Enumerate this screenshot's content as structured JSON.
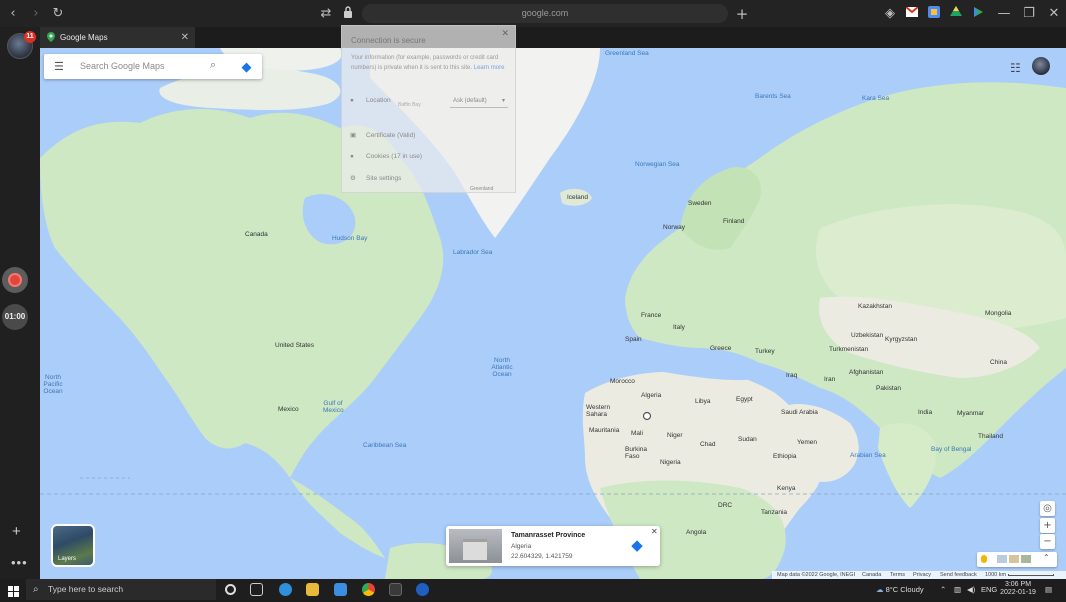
{
  "browser": {
    "url": "google.com",
    "tab_title": "Google Maps",
    "profile_badge": "11",
    "timer": "01:00"
  },
  "maps": {
    "search_placeholder": "Search Google Maps",
    "layers_label": "Layers"
  },
  "security_popup": {
    "title": "Connection is secure",
    "description": "Your information (for example, passwords or credit card numbers) is private when it is sent to this site.",
    "learn_more": "Learn more",
    "location_label": "Location",
    "location_sub": "Baffin Bay",
    "location_value": "Ask (default)",
    "certificate": "Certificate (Valid)",
    "cookies": "Cookies (17 in use)",
    "site_settings": "Site settings",
    "bottom_label": "Greenland"
  },
  "place_card": {
    "title": "Tamanrasset Province",
    "country": "Algeria",
    "coords": "22.604329, 1.421759"
  },
  "map_labels": {
    "greenland_sea": "Greenland Sea",
    "barents_sea": "Barents Sea",
    "kara_sea": "Kara Sea",
    "norwegian_sea": "Norwegian Sea",
    "iceland": "Iceland",
    "sweden": "Sweden",
    "finland": "Finland",
    "norway": "Norway",
    "canada": "Canada",
    "hudson_bay": "Hudson Bay",
    "labrador_sea": "Labrador Sea",
    "united_states": "United States",
    "mexico": "Mexico",
    "gulf_of_mexico": "Gulf of Mexico",
    "caribbean_sea": "Caribbean Sea",
    "north_pacific_ocean": "North Pacific Ocean",
    "north_atlantic_ocean": "North Atlantic Ocean",
    "france": "France",
    "spain": "Spain",
    "italy": "Italy",
    "greece": "Greece",
    "turkey": "Turkey",
    "kazakhstan": "Kazakhstan",
    "mongolia": "Mongolia",
    "china": "China",
    "uzbekistan": "Uzbekistan",
    "turkmenistan": "Turkmenistan",
    "kyrgyzstan": "Kyrgyzstan",
    "afghanistan": "Afghanistan",
    "pakistan": "Pakistan",
    "iran": "Iran",
    "iraq": "Iraq",
    "saudi_arabia": "Saudi Arabia",
    "yemen": "Yemen",
    "india": "India",
    "egypt": "Egypt",
    "libya": "Libya",
    "algeria": "Algeria",
    "morocco": "Morocco",
    "western_sahara": "Western Sahara",
    "mauritania": "Mauritania",
    "mali": "Mali",
    "niger": "Niger",
    "chad": "Chad",
    "sudan": "Sudan",
    "ethiopia": "Ethiopia",
    "nigeria": "Nigeria",
    "burkina_faso": "Burkina Faso",
    "drc": "DRC",
    "tanzania": "Tanzania",
    "kenya": "Kenya",
    "angola": "Angola",
    "arabian_sea": "Arabian Sea",
    "bay_of_bengal": "Bay of Bengal",
    "thailand": "Thailand",
    "myanmar": "Myanmar"
  },
  "map_footer": {
    "map_data": "Map data ©2022 Google, INEGI",
    "canada": "Canada",
    "terms": "Terms",
    "privacy": "Privacy",
    "send_feedback": "Send feedback",
    "scale": "1000 km"
  },
  "taskbar": {
    "search_placeholder": "Type here to search",
    "weather": "8°C  Cloudy",
    "language": "ENG",
    "time": "3:06 PM",
    "date": "2022-01-19"
  },
  "colors": {
    "water": "#abcdfa",
    "land": "#cde8c3",
    "land_dry": "#ecebe2",
    "ice": "#f2f3f0",
    "accent": "#1a73e8"
  }
}
